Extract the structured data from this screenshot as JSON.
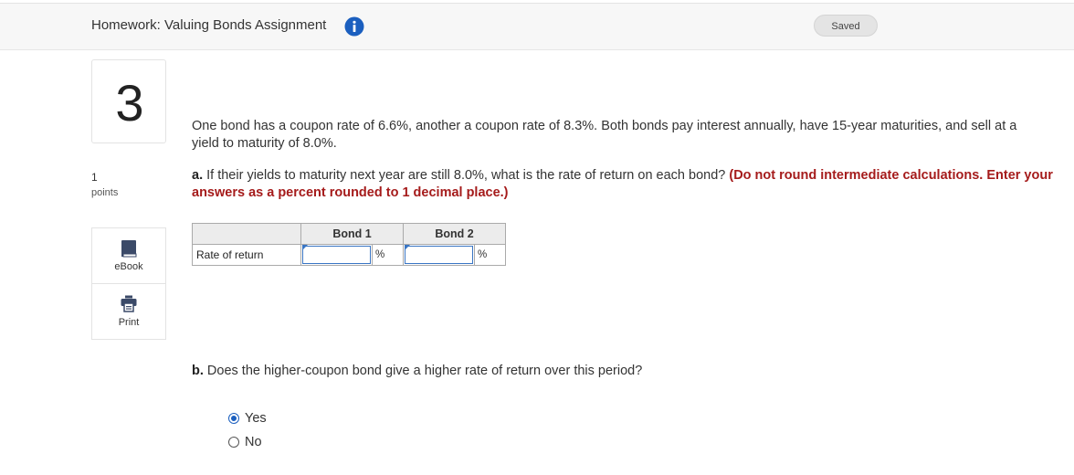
{
  "header": {
    "title": "Homework: Valuing Bonds Assignment",
    "info_icon": "info-icon",
    "status": "Saved"
  },
  "question": {
    "number": "3",
    "points_value": "1",
    "points_label": "points",
    "tools": [
      {
        "label": "eBook",
        "icon": "book-icon"
      },
      {
        "label": "Print",
        "icon": "printer-icon"
      }
    ],
    "stem": "One bond has a coupon rate of 6.6%, another a coupon rate of 8.3%. Both bonds pay interest annually, have 15-year maturities, and sell at a yield to maturity of 8.0%.",
    "part_a": {
      "prefix": "a.",
      "text": " If their yields to maturity next year are still 8.0%, what is the rate of return on each bond? ",
      "instruction": "(Do not round intermediate calculations. Enter your answers as a percent rounded to 1 decimal place.)"
    },
    "table": {
      "headers": [
        "",
        "Bond 1",
        "Bond 2"
      ],
      "row_label": "Rate of return",
      "bond1_value": "",
      "bond2_value": "",
      "unit": "%"
    },
    "part_b": {
      "prefix": "b.",
      "text": " Does the higher-coupon bond give a higher rate of return over this period?",
      "options": [
        {
          "label": "Yes",
          "selected": true
        },
        {
          "label": "No",
          "selected": false
        }
      ]
    }
  },
  "colors": {
    "accent_blue": "#1b5fbf",
    "instruction_red": "#a51b1b",
    "header_bg": "#f7f7f7"
  }
}
